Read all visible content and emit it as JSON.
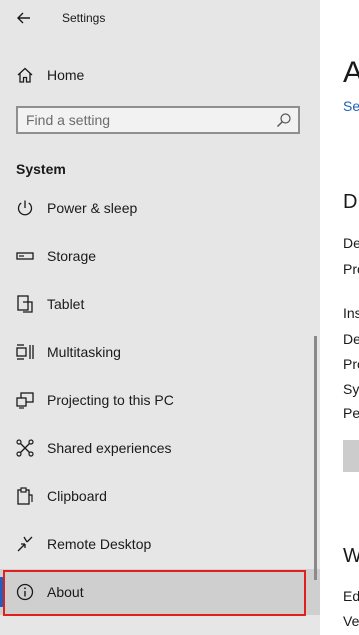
{
  "app": {
    "title": "Settings"
  },
  "nav": {
    "home_label": "Home",
    "search_placeholder": "Find a setting",
    "section_title": "System",
    "items": [
      {
        "label": "Power & sleep",
        "icon": "power-icon"
      },
      {
        "label": "Storage",
        "icon": "storage-icon"
      },
      {
        "label": "Tablet",
        "icon": "tablet-icon"
      },
      {
        "label": "Multitasking",
        "icon": "multitasking-icon"
      },
      {
        "label": "Projecting to this PC",
        "icon": "projecting-icon"
      },
      {
        "label": "Shared experiences",
        "icon": "shared-experiences-icon"
      },
      {
        "label": "Clipboard",
        "icon": "clipboard-icon"
      },
      {
        "label": "Remote Desktop",
        "icon": "remote-desktop-icon"
      },
      {
        "label": "About",
        "icon": "info-icon",
        "selected": true
      }
    ]
  },
  "main": {
    "title_fragment": "A",
    "link_fragment": "Se",
    "heading1_fragment": "D",
    "rows1": [
      "De",
      "Pro"
    ],
    "rows2": [
      "Ins",
      "De",
      "Pro",
      "Sy",
      "Pe"
    ],
    "heading2_fragment": "W",
    "rows3": [
      "Ed",
      "Ve"
    ]
  },
  "colors": {
    "sidebar_bg": "#e6e6e6",
    "selected_bg": "#cfcfcf",
    "accent": "#1f5fbf",
    "highlight_border": "#e0201f",
    "link": "#1b62b8"
  }
}
